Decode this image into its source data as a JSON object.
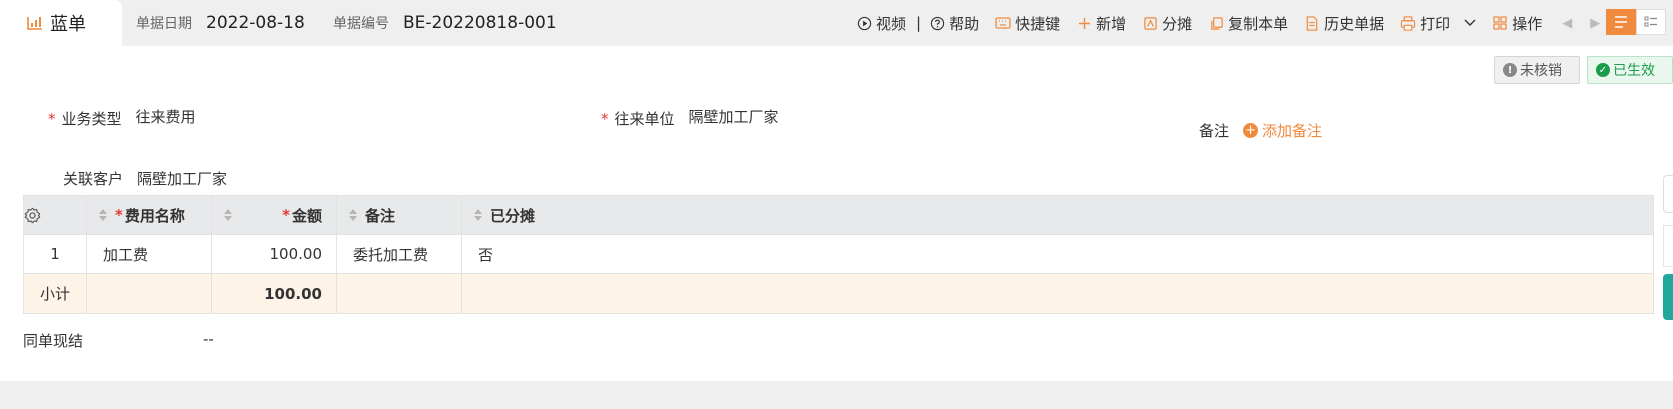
{
  "tab": {
    "label": "蓝单"
  },
  "header": {
    "date_label": "单据日期",
    "date_value": "2022-08-18",
    "number_label": "单据编号",
    "number_value": "BE-20220818-001"
  },
  "toolbar": {
    "video": "视频",
    "sep": "|",
    "help": "帮助",
    "shortcut": "快捷键",
    "add": "新增",
    "allocate": "分摊",
    "copy": "复制本单",
    "history": "历史单据",
    "print": "打印",
    "ops": "操作"
  },
  "status": {
    "unverified": "未核销",
    "effective": "已生效"
  },
  "form": {
    "business_type_label": "业务类型",
    "business_type_value": "往来费用",
    "partner_label": "往来单位",
    "partner_value": "隔壁加工厂家",
    "remark_label": "备注",
    "add_remark": "添加备注",
    "customer_label": "关联客户",
    "customer_value": "隔壁加工厂家"
  },
  "table": {
    "headers": {
      "name": "费用名称",
      "amount": "金额",
      "remark": "备注",
      "allocated": "已分摊"
    },
    "rows": [
      {
        "index": "1",
        "name": "加工费",
        "amount": "100.00",
        "remark": "委托加工费",
        "allocated": "否"
      }
    ],
    "subtotal": {
      "label": "小计",
      "amount": "100.00"
    }
  },
  "cash": {
    "label": "同单现结",
    "value": "--"
  },
  "colors": {
    "accent": "#f08a3c",
    "required": "#e53935",
    "effective": "#1a9c4a"
  }
}
